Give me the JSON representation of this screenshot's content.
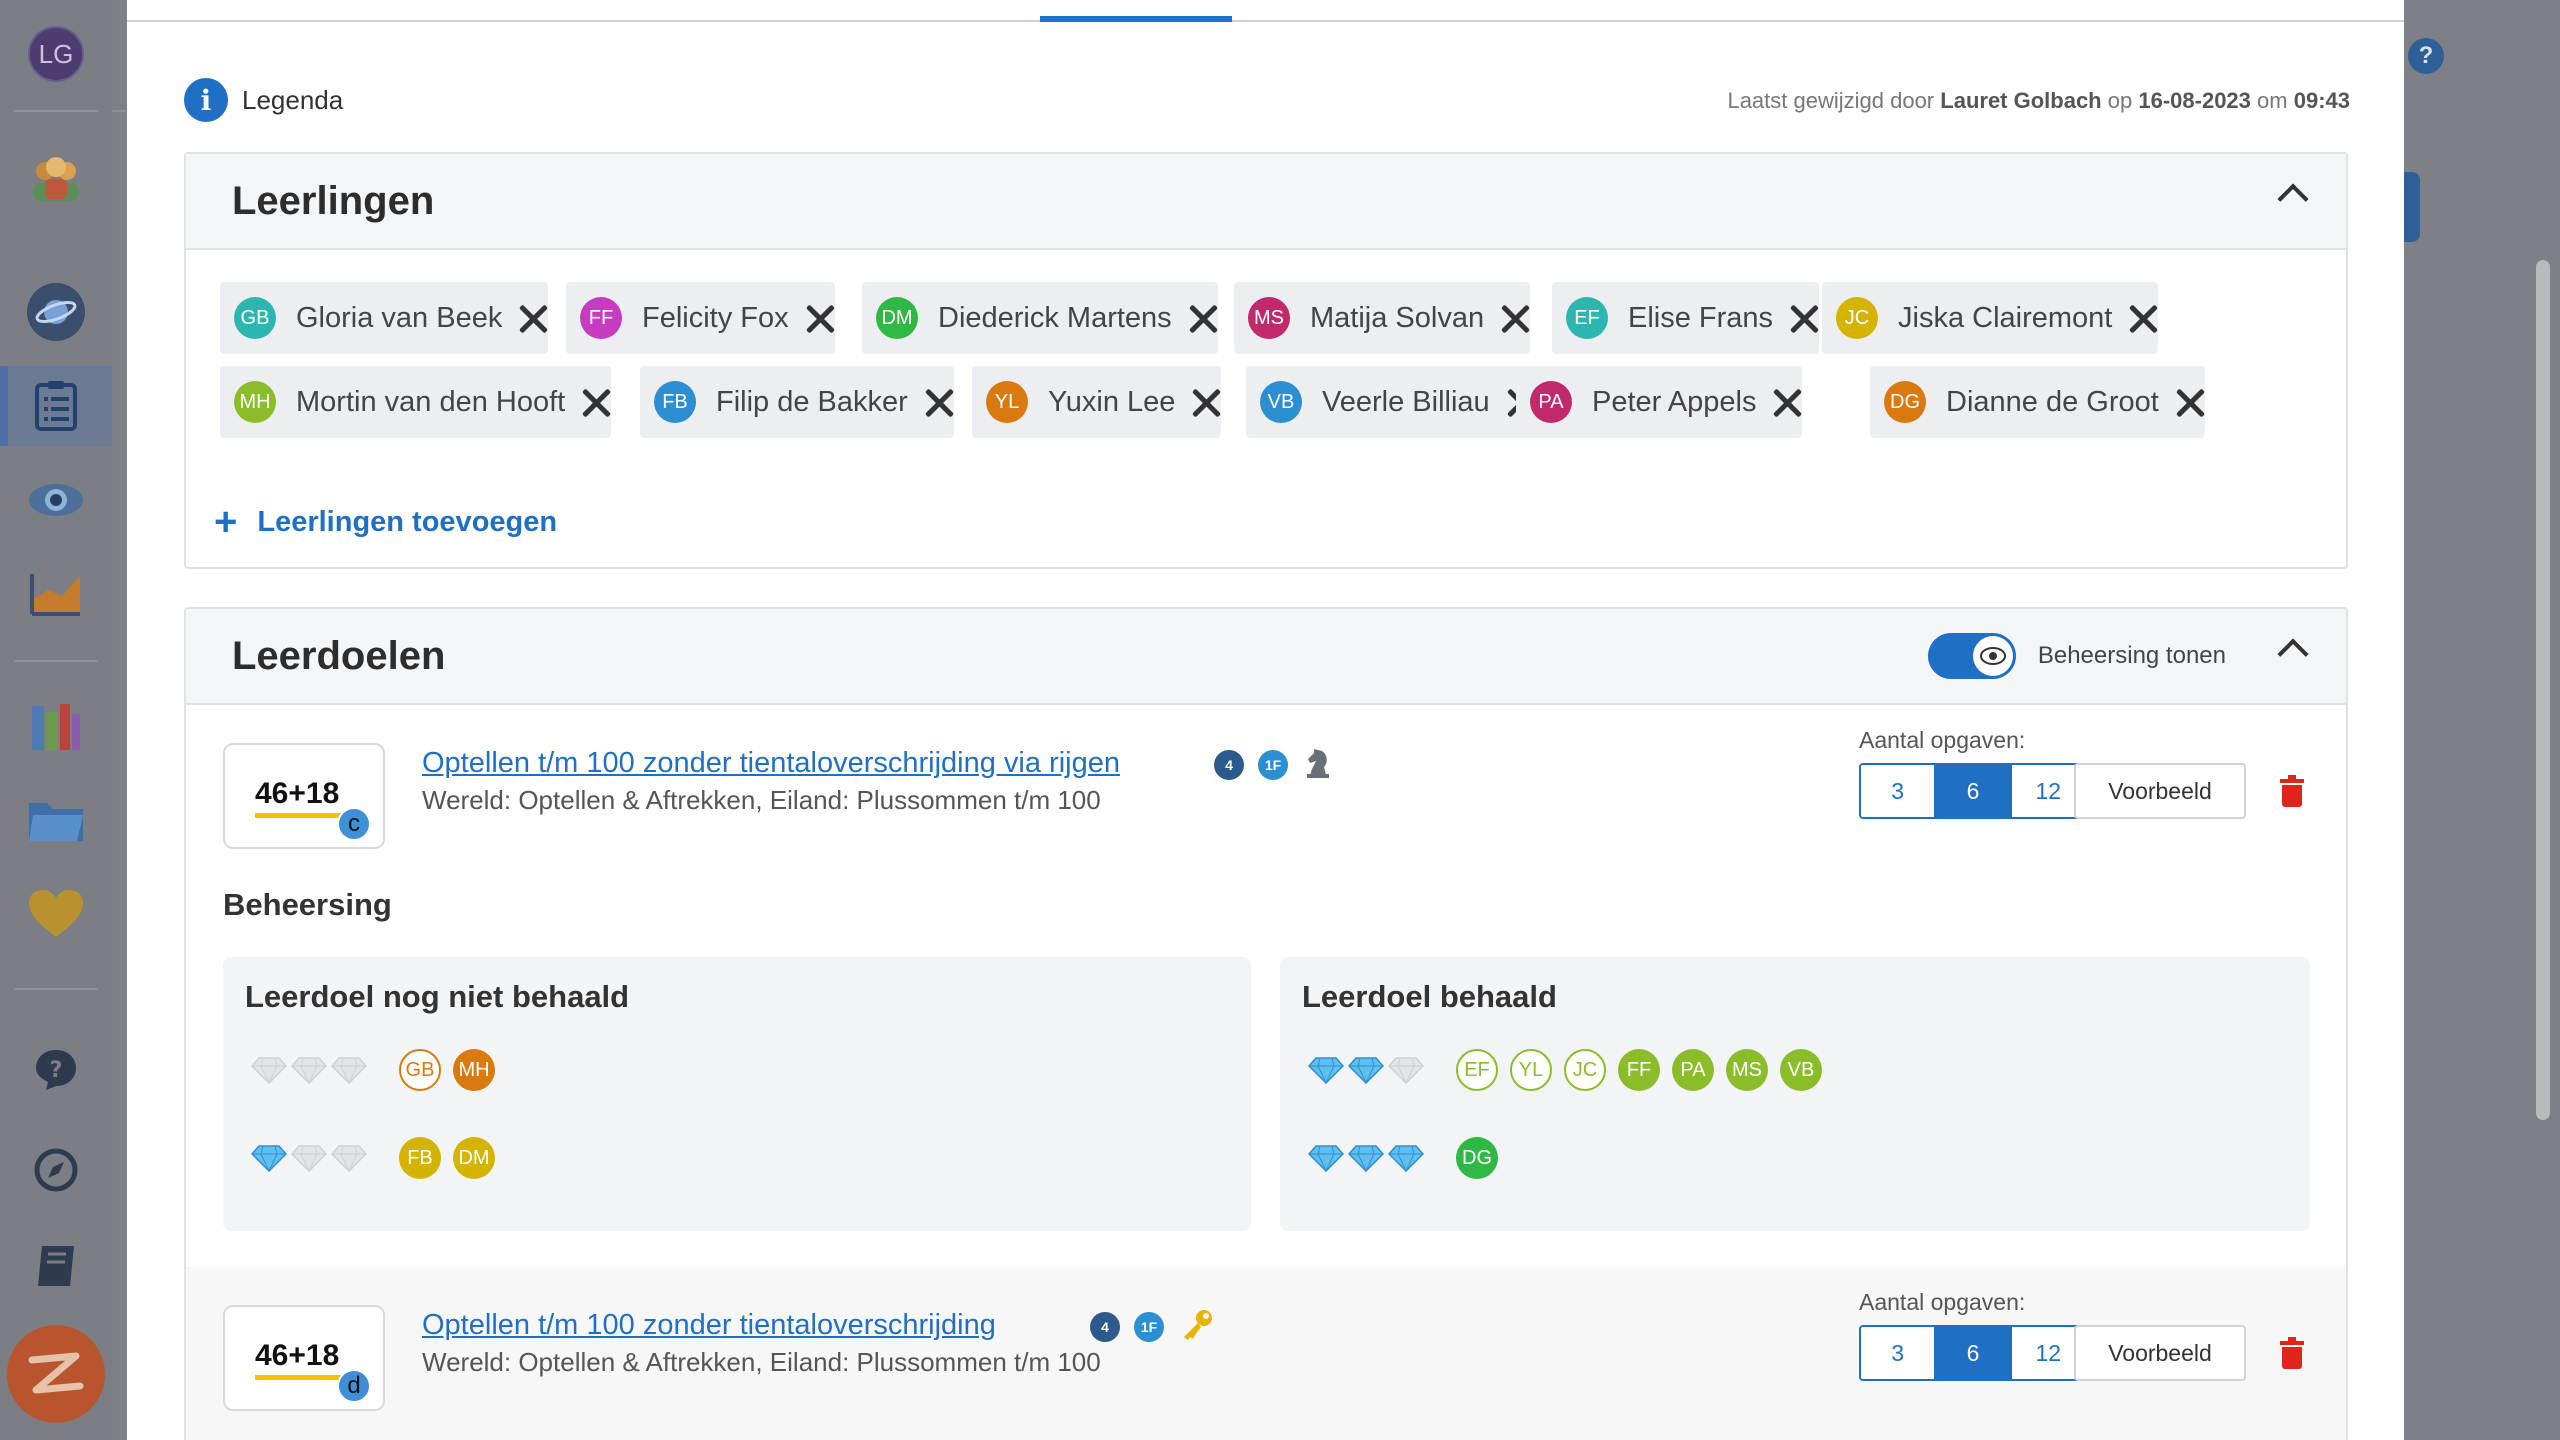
{
  "user": {
    "initials": "LG"
  },
  "sidebar": {
    "items": [
      "groups-icon",
      "planet-icon",
      "list-icon",
      "eye-icon",
      "chart-icon",
      "books-icon",
      "folder-icon",
      "heart-icon",
      "help-icon",
      "compass-icon",
      "book-icon",
      "brand-logo-icon"
    ]
  },
  "header": {
    "legend_label": "Legenda",
    "modified_prefix": "Laatst gewijzigd door",
    "modified_by": "Lauret Golbach",
    "modified_on_label": "op",
    "modified_date": "16-08-2023",
    "modified_at_label": "om",
    "modified_time": "09:43"
  },
  "students_panel": {
    "title": "Leerlingen",
    "add_label": "Leerlingen toevoegen",
    "students": [
      {
        "initials": "GB",
        "name": "Gloria van Beek",
        "color": "#2bb7b0"
      },
      {
        "initials": "FF",
        "name": "Felicity Fox",
        "color": "#c63bbf"
      },
      {
        "initials": "DM",
        "name": "Diederick Martens",
        "color": "#2fb843"
      },
      {
        "initials": "MS",
        "name": "Matija Solvan",
        "color": "#c02a6b"
      },
      {
        "initials": "EF",
        "name": "Elise Frans",
        "color": "#2bb7b0"
      },
      {
        "initials": "JC",
        "name": "Jiska Clairemont",
        "color": "#d4b400"
      },
      {
        "initials": "MH",
        "name": "Mortin van den Hooft",
        "color": "#8bbd2b"
      },
      {
        "initials": "FB",
        "name": "Filip de Bakker",
        "color": "#2b8fd1"
      },
      {
        "initials": "YL",
        "name": "Yuxin Lee",
        "color": "#d97a10"
      },
      {
        "initials": "VB",
        "name": "Veerle Billiau",
        "color": "#2b8fd1"
      },
      {
        "initials": "PA",
        "name": "Peter Appels",
        "color": "#c02a6b"
      },
      {
        "initials": "DG",
        "name": "Dianne de Groot",
        "color": "#d97a10"
      }
    ]
  },
  "goals_panel": {
    "title": "Leerdoelen",
    "toggle_label": "Beheersing tonen",
    "toggle_on": true,
    "count_label": "Aantal opgaven:",
    "count_options": [
      "3",
      "6",
      "12"
    ],
    "preview_label": "Voorbeeld",
    "mastery_title": "Beheersing",
    "not_achieved_title": "Leerdoel nog niet behaald",
    "achieved_title": "Leerdoel behaald",
    "goals": [
      {
        "thumb_text": "46+18",
        "level": "c",
        "title": "Optellen t/m 100 zonder tientaloverschrijding via rijgen",
        "badges": [
          "4",
          "1F"
        ],
        "extra_icon": "chess-knight-icon",
        "subtitle": "Wereld: Optellen & Aftrekken, Eiland: Plussommen t/m 100",
        "selected_count": "6"
      },
      {
        "thumb_text": "46+18",
        "level": "d",
        "title": "Optellen t/m 100 zonder tientaloverschrijding",
        "badges": [
          "4",
          "1F"
        ],
        "extra_icon": "key-icon",
        "subtitle": "Wereld: Optellen & Aftrekken, Eiland: Plussommen t/m 100",
        "selected_count": "6"
      }
    ],
    "mastery": {
      "not_achieved": [
        {
          "gems_filled": 0,
          "students": [
            {
              "initials": "GB",
              "style": "outline",
              "color": "#d97a10"
            },
            {
              "initials": "MH",
              "style": "fill",
              "color": "#d97a10"
            }
          ]
        },
        {
          "gems_filled": 1,
          "students": [
            {
              "initials": "FB",
              "style": "fill",
              "color": "#d4b400"
            },
            {
              "initials": "DM",
              "style": "fill",
              "color": "#d4b400"
            }
          ]
        }
      ],
      "achieved": [
        {
          "gems_filled": 2,
          "students": [
            {
              "initials": "EF",
              "style": "outline",
              "color": "#8bbd2b"
            },
            {
              "initials": "YL",
              "style": "outline",
              "color": "#8bbd2b"
            },
            {
              "initials": "JC",
              "style": "outline",
              "color": "#8bbd2b"
            },
            {
              "initials": "FF",
              "style": "fill",
              "color": "#8bbd2b"
            },
            {
              "initials": "PA",
              "style": "fill",
              "color": "#8bbd2b"
            },
            {
              "initials": "MS",
              "style": "fill",
              "color": "#8bbd2b"
            },
            {
              "initials": "VB",
              "style": "fill",
              "color": "#8bbd2b"
            }
          ]
        },
        {
          "gems_filled": 3,
          "students": [
            {
              "initials": "DG",
              "style": "fill",
              "color": "#2fb843"
            }
          ]
        }
      ]
    }
  },
  "colors": {
    "accent": "#1f6fc5",
    "danger": "#e0241b"
  }
}
